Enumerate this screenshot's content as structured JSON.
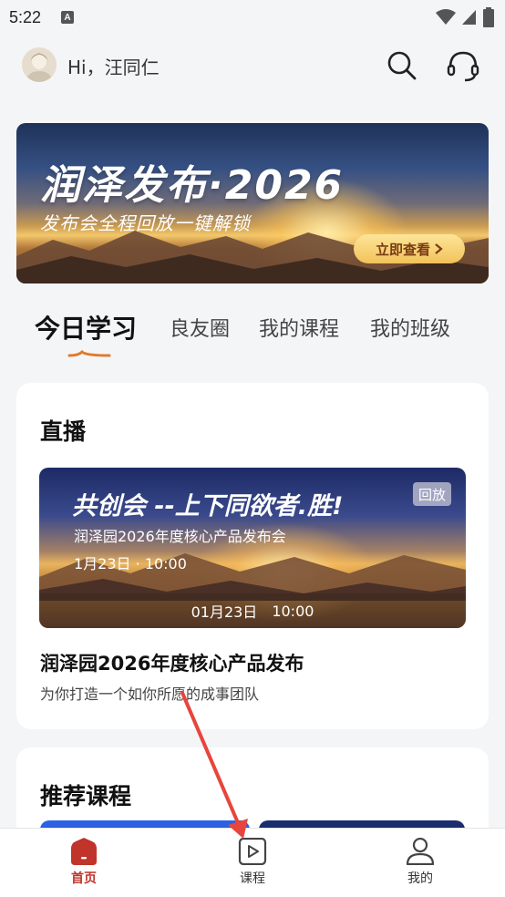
{
  "status_bar": {
    "time": "5:22",
    "notification_icon": "A"
  },
  "header": {
    "greeting": "Hi，汪同仁",
    "search_icon": "search-icon",
    "support_icon": "headset-icon"
  },
  "banner": {
    "title": "润泽发布·2026",
    "subtitle": "发布会全程回放一键解锁",
    "cta_label": "立即查看"
  },
  "tabs": [
    {
      "label": "今日学习",
      "active": true
    },
    {
      "label": "良友圈",
      "active": false
    },
    {
      "label": "我的课程",
      "active": false
    },
    {
      "label": "我的班级",
      "active": false
    }
  ],
  "live": {
    "section_title": "直播",
    "thumb_title": "共创会 --上下同欲者.胜!",
    "thumb_subtitle": "润泽园2026年度核心产品发布会",
    "thumb_date": "1月23日 · 10:00",
    "badge": "回放",
    "footer_date": "01月23日",
    "footer_time": "10:00",
    "title": "润泽园2026年度核心产品发布",
    "description": "为你打造一个如你所愿的成事团队"
  },
  "recommended": {
    "section_title": "推荐课程"
  },
  "bottom_nav": [
    {
      "label": "首页",
      "icon": "home-icon",
      "active": true
    },
    {
      "label": "课程",
      "icon": "play-icon",
      "active": false
    },
    {
      "label": "我的",
      "icon": "user-icon",
      "active": false
    }
  ],
  "colors": {
    "accent": "#c0342b",
    "background": "#f4f5f7",
    "cta_text": "#7a3c12"
  }
}
